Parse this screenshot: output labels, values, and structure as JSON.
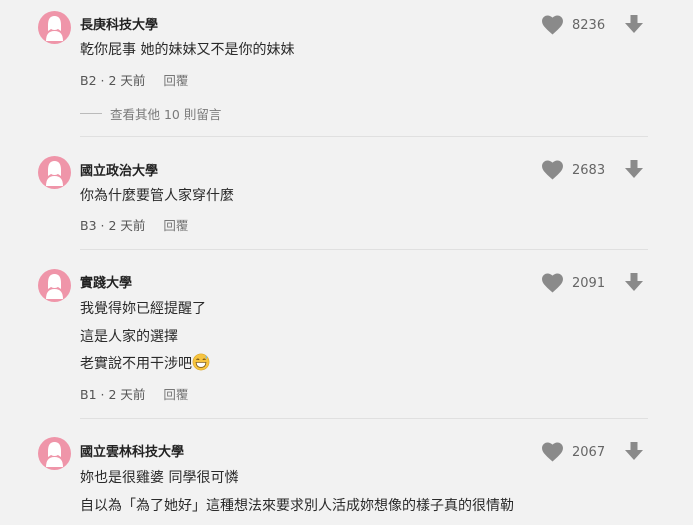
{
  "comments": [
    {
      "school": "長庚科技大學",
      "lines": [
        "乾你屁事 她的妹妹又不是你的妹妹"
      ],
      "floor": "B2",
      "time": "2 天前",
      "reply_label": "回覆",
      "likes": "8236",
      "more_replies": "查看其他 10 則留言"
    },
    {
      "school": "國立政治大學",
      "lines": [
        "你為什麼要管人家穿什麼"
      ],
      "floor": "B3",
      "time": "2 天前",
      "reply_label": "回覆",
      "likes": "2683"
    },
    {
      "school": "實踐大學",
      "lines": [
        "我覺得妳已經提醒了",
        "這是人家的選擇",
        "老實說不用干涉吧"
      ],
      "floor": "B1",
      "time": "2 天前",
      "reply_label": "回覆",
      "likes": "2091"
    },
    {
      "school": "國立雲林科技大學",
      "lines": [
        "妳也是很雞婆 同學很可憐",
        "自以為「為了她好」這種想法來要求別人活成妳想像的樣子真的很情勒"
      ],
      "likes": "2067"
    }
  ],
  "colors": {
    "background": "#f2f2f2",
    "avatar": "#ef95a9",
    "icon_gray": "#8a8a8a",
    "divider": "#e0e0e0"
  },
  "icons": {
    "heart": "heart-icon",
    "down": "arrow-down-icon",
    "avatar": "female-avatar-icon",
    "emoji": "grinning-sweat-emoji-icon"
  }
}
